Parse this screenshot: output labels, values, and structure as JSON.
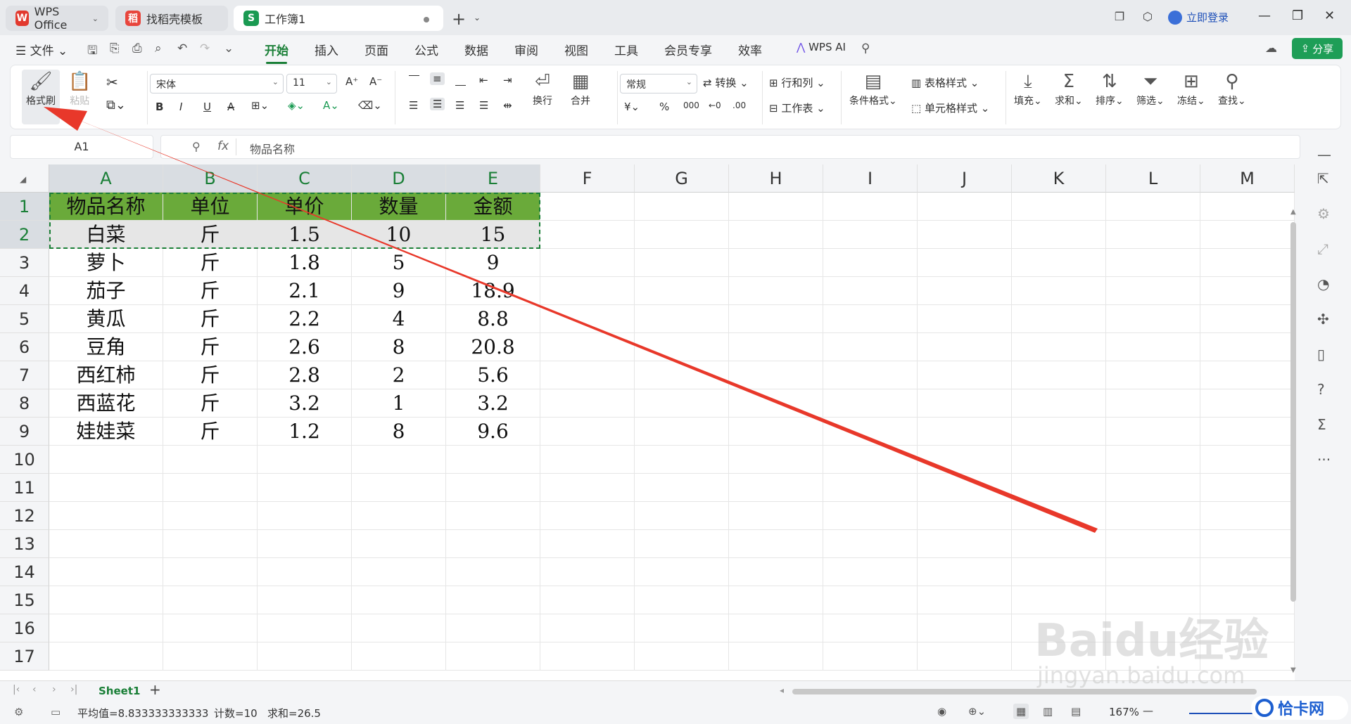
{
  "tabs": [
    {
      "label": "WPS Office",
      "logo": "W"
    },
    {
      "label": "找稻壳模板",
      "logo": "稻"
    },
    {
      "label": "工作簿1",
      "logo": "S"
    }
  ],
  "login_label": "立即登录",
  "menu": {
    "file": "文件",
    "items": [
      "开始",
      "插入",
      "页面",
      "公式",
      "数据",
      "审阅",
      "视图",
      "工具",
      "会员专享",
      "效率"
    ],
    "ai": "WPS AI",
    "share": "分享"
  },
  "ribbon": {
    "format_painter": "格式刷",
    "paste": "粘贴",
    "font": "宋体",
    "size": "11",
    "wrap": "换行",
    "merge": "合并",
    "number_format": "常规",
    "convert": "转换",
    "row_col": "行和列",
    "worksheet": "工作表",
    "cond_format": "条件格式",
    "table_style": "表格样式",
    "cell_style": "单元格样式",
    "fill": "填充",
    "sum": "求和",
    "sort": "排序",
    "filter": "筛选",
    "freeze": "冻结",
    "find": "查找"
  },
  "namebox": "A1",
  "formula": "物品名称",
  "columns": [
    "A",
    "B",
    "C",
    "D",
    "E",
    "F",
    "G",
    "H",
    "I",
    "J",
    "K",
    "L",
    "M"
  ],
  "rows": [
    "1",
    "2",
    "3",
    "4",
    "5",
    "6",
    "7",
    "8",
    "9",
    "10",
    "11",
    "12",
    "13",
    "14",
    "15",
    "16",
    "17"
  ],
  "table": [
    [
      "物品名称",
      "单位",
      "单价",
      "数量",
      "金额"
    ],
    [
      "白菜",
      "斤",
      "1.5",
      "10",
      "15"
    ],
    [
      "萝卜",
      "斤",
      "1.8",
      "5",
      "9"
    ],
    [
      "茄子",
      "斤",
      "2.1",
      "9",
      "18.9"
    ],
    [
      "黄瓜",
      "斤",
      "2.2",
      "4",
      "8.8"
    ],
    [
      "豆角",
      "斤",
      "2.6",
      "8",
      "20.8"
    ],
    [
      "西红柿",
      "斤",
      "2.8",
      "2",
      "5.6"
    ],
    [
      "西蓝花",
      "斤",
      "3.2",
      "1",
      "3.2"
    ],
    [
      "娃娃菜",
      "斤",
      "1.2",
      "8",
      "9.6"
    ]
  ],
  "sheet_tab": "Sheet1",
  "status": {
    "avg": "平均值=8.833333333333",
    "count": "计数=10",
    "sum": "求和=26.5",
    "zoom": "167%"
  },
  "watermark": "Baidu经验",
  "watermark_url": "jingyan.baidu.com",
  "corner_logo": "恰卡网",
  "colors": {
    "accent": "#1a7f37",
    "header_fill": "#6aaa3a",
    "arrow": "#e8382a",
    "share": "#1e9e57"
  }
}
